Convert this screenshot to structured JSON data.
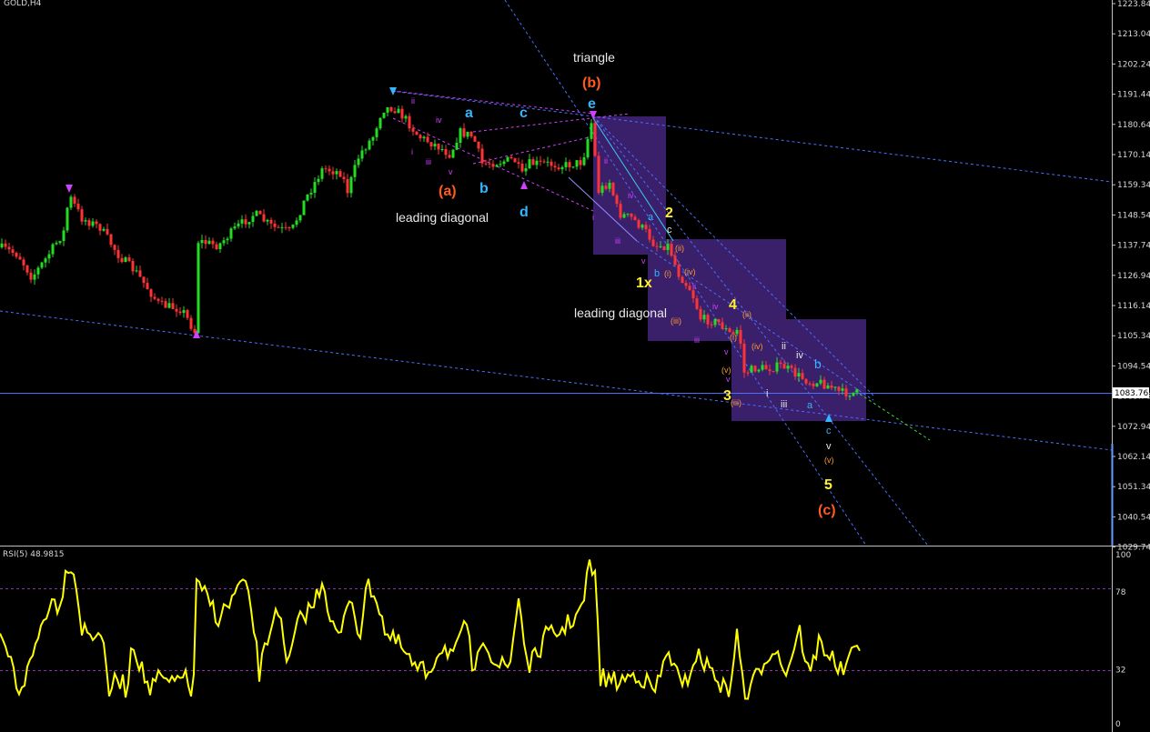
{
  "window": {
    "title": "GOLD,H4"
  },
  "colors": {
    "background": "#000000",
    "bull_candle": "#22dd22",
    "bear_candle": "#ff3333",
    "rsi_line": "#ffff00",
    "trend_line": "#4a6fff",
    "box_fill": "#3a1f6b",
    "label_red": "#ff5a1f",
    "label_cyan": "#33b5ff",
    "label_yellow": "#ffee33",
    "label_magenta": "#d040ff",
    "label_orange": "#ff9a33",
    "label_white": "#e8e8e8"
  },
  "main_axis": {
    "ticks": [
      "1223.84",
      "1213.04",
      "1202.24",
      "1191.44",
      "1180.64",
      "1170.14",
      "1159.34",
      "1148.54",
      "1137.74",
      "1126.94",
      "1116.14",
      "1105.34",
      "1094.54",
      "1083.76",
      "1072.94",
      "1062.14",
      "1051.34",
      "1040.54",
      "1029.74"
    ],
    "current_price": "1083.76"
  },
  "rsi": {
    "title": "RSI(5) 48.9815",
    "axis_ticks": [
      "100",
      "78",
      "32",
      "0"
    ],
    "levels": [
      78,
      32
    ]
  },
  "annotations": {
    "triangle": "triangle",
    "b_paren": "(b)",
    "e_top": "e",
    "a_paren": "(a)",
    "c_paren": "(c)",
    "leading_diagonal_1": "leading diagonal",
    "leading_diagonal_2": "leading diagonal",
    "a_tri": "a",
    "b_tri": "b",
    "c_tri": "c",
    "d_tri": "d",
    "ii_1": "ii",
    "iv_1": "iv",
    "iii_1": "iii",
    "v_1": "v",
    "i_1": "i",
    "wave_2": "2",
    "wave_1x": "1x",
    "wave_3": "3",
    "wave_4": "4",
    "wave_5": "5",
    "a_small": "a",
    "b_small": "b",
    "c_small": "c",
    "ii_2": "ii",
    "iii_2": "iii",
    "iv_2": "iv",
    "v_2": "v",
    "i_2": "i",
    "ii_paren": "(ii)",
    "i_paren": "(i)",
    "iv_paren": "(iv)",
    "iii_paren": "(iii)",
    "ii_3": "ii",
    "iv_3": "iv",
    "iii_3": "iii",
    "v_3": "v",
    "ii_paren_2": "(ii)",
    "i_paren_2": "(i)",
    "iv_paren_2": "(iv)",
    "v_paren": "(v)",
    "iii_paren_2": "(iii)",
    "i_4": "i",
    "ii_4": "ii",
    "iii_4": "iii",
    "iv_4": "iv",
    "a_4": "a",
    "b_4": "b",
    "c_4": "c",
    "v_4": "v",
    "v_paren_2": "(v)",
    "v_5": "v"
  }
}
